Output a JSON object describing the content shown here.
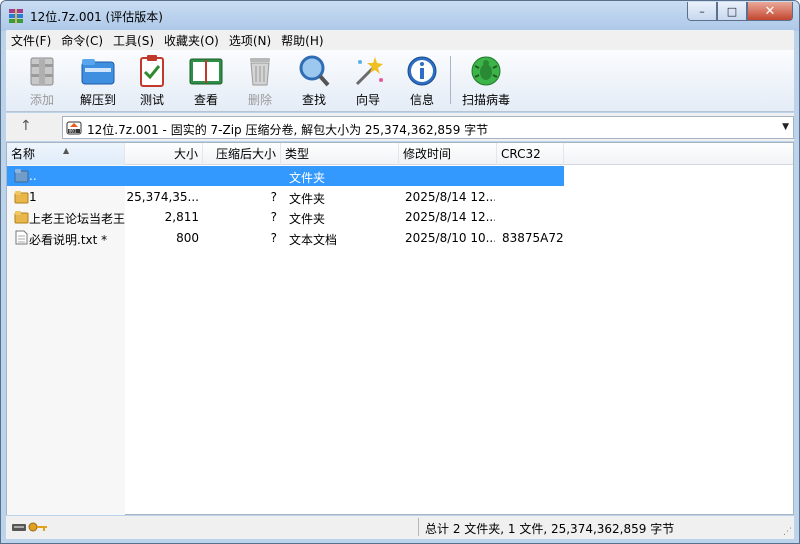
{
  "window": {
    "title": "12位.7z.001 (评估版本)",
    "minimize": "–",
    "maximize": "□",
    "close": "✕"
  },
  "menu": [
    "文件(F)",
    "命令(C)",
    "工具(S)",
    "收藏夹(O)",
    "选项(N)",
    "帮助(H)"
  ],
  "toolbar": {
    "add": "添加",
    "extract": "解压到",
    "test": "测试",
    "view": "查看",
    "delete": "删除",
    "find": "查找",
    "wizard": "向导",
    "info": "信息",
    "virus": "扫描病毒"
  },
  "address": {
    "up": "↑",
    "path": "12位.7z.001 - 固实的 7-Zip 压缩分卷, 解包大小为 25,374,362,859 字节",
    "dropdown": "▼"
  },
  "columns": {
    "name": "名称",
    "size": "大小",
    "packed": "压缩后大小",
    "type": "类型",
    "modified": "修改时间",
    "crc": "CRC32"
  },
  "files": [
    {
      "name": "..",
      "size": "",
      "packed": "",
      "type": "文件夹",
      "modified": "",
      "crc": "",
      "icon": "up-folder-icon"
    },
    {
      "name": "1",
      "size": "25,374,35...",
      "packed": "?",
      "type": "文件夹",
      "modified": "2025/8/14 12...",
      "crc": "",
      "icon": "folder-icon"
    },
    {
      "name": "上老王论坛当老王",
      "size": "2,811",
      "packed": "?",
      "type": "文件夹",
      "modified": "2025/8/14 12...",
      "crc": "",
      "icon": "folder-icon"
    },
    {
      "name": "必看说明.txt *",
      "size": "800",
      "packed": "?",
      "type": "文本文档",
      "modified": "2025/8/10 10...",
      "crc": "83875A72",
      "icon": "text-file-icon"
    }
  ],
  "status": {
    "summary": "总计 2 文件夹, 1 文件, 25,374,362,859 字节"
  },
  "colors": {
    "selection": "#3399ff",
    "titlebar": "#b9d1ea"
  }
}
